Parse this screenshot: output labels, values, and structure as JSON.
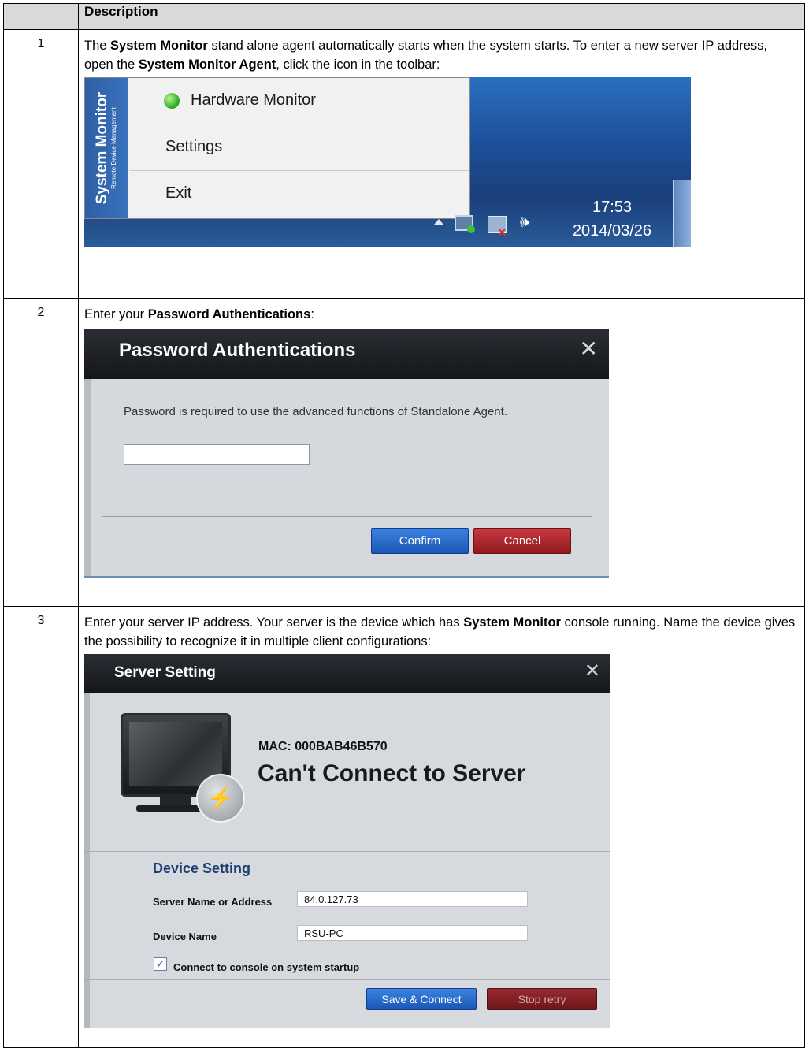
{
  "table": {
    "header_num": "",
    "header_description": "Description"
  },
  "step1": {
    "num": "1",
    "t1": "The ",
    "b1": "System Monitor",
    "t2": " stand alone agent automatically starts when the system starts. To enter a new server IP address, open the ",
    "b2": "System Monitor Agent",
    "t3": ", click the icon in the toolbar:",
    "menu": {
      "band_title": "System Monitor",
      "band_subtitle": "Remote Device Management",
      "items": [
        "Hardware Monitor",
        "Settings",
        "Exit"
      ]
    },
    "tray": {
      "time": "17:53",
      "date": "2014/03/26"
    }
  },
  "step2": {
    "num": "2",
    "t1": "Enter your ",
    "b1": "Password Authentications",
    "t2": ":",
    "dialog": {
      "title": "Password Authentications",
      "message": "Password is required to use the advanced functions of Standalone Agent.",
      "password_value": "",
      "confirm": "Confirm",
      "cancel": "Cancel"
    }
  },
  "step3": {
    "num": "3",
    "t1": "Enter your server IP address. Your server is the device which has ",
    "b1": "System Monitor",
    "t2": " console running. Name the device gives the possibility to recognize it in multiple client configurations:",
    "dialog": {
      "title": "Server Setting",
      "mac": "MAC: 000BAB46B570",
      "status": "Can't Connect to Server",
      "section": "Device Setting",
      "server_label": "Server Name or Address",
      "server_value": "84.0.127.73",
      "device_label": "Device Name",
      "device_value": "RSU-PC",
      "checkbox_label": "Connect to console on system startup",
      "checkbox_checked": true,
      "save": "Save & Connect",
      "stop": "Stop retry"
    }
  },
  "colors": {
    "header_bg": "#d9d9d9",
    "dialog_title_bg": "#1b1d21",
    "primary_button": "#1f5fc0",
    "danger_button": "#a82228",
    "taskbar": "#1c4f98"
  }
}
